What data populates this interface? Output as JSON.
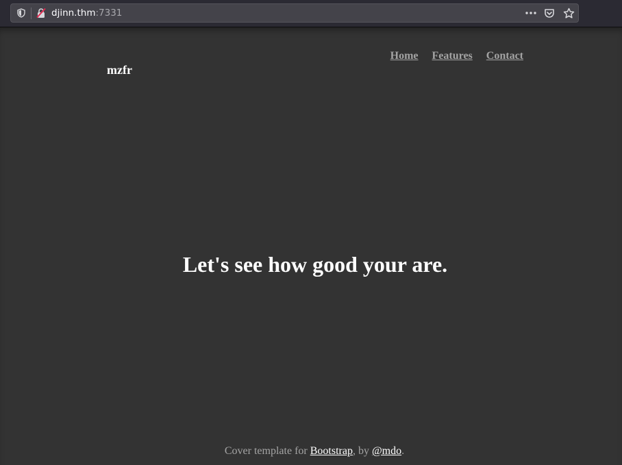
{
  "browser": {
    "url_host": "djinn.thm",
    "url_port": ":7331",
    "icons": [
      "shield-icon",
      "insecure-lock-icon",
      "more-icon",
      "pocket-icon",
      "star-icon"
    ]
  },
  "site": {
    "brand": "mzfr",
    "nav": [
      {
        "label": "Home"
      },
      {
        "label": "Features"
      },
      {
        "label": "Contact"
      }
    ],
    "headline": "Let's see how good your are.",
    "footer": {
      "prefix": "Cover template for ",
      "link1": "Bootstrap",
      "middle": ", by ",
      "link2": "@mdo",
      "suffix": "."
    }
  },
  "colors": {
    "page_bg": "#333333",
    "toolbar_bg": "#2b2a33",
    "urlbar_bg": "#44434a"
  }
}
